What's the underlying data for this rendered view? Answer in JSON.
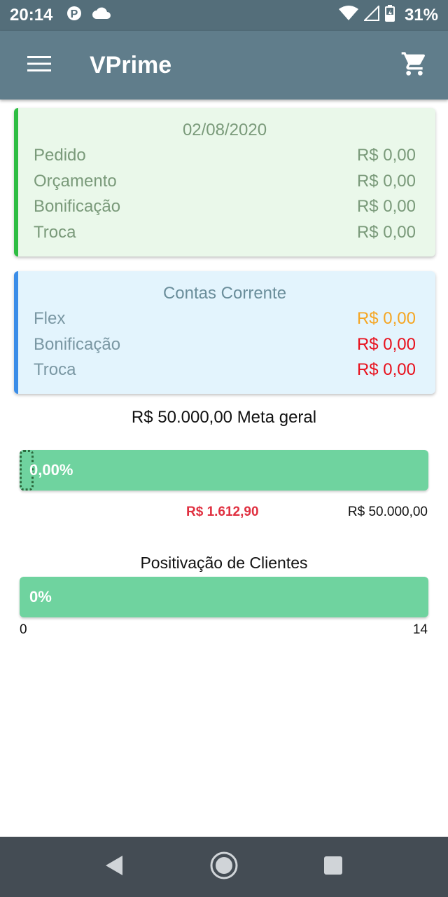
{
  "status_bar": {
    "time": "20:14",
    "battery_percent": "31%",
    "icons": [
      "parking-icon",
      "cloud-icon",
      "wifi-icon",
      "cellular-icon",
      "battery-icon"
    ]
  },
  "app_bar": {
    "title": "VPrime",
    "icons": [
      "menu-icon",
      "cart-icon"
    ]
  },
  "daily_card": {
    "date": "02/08/2020",
    "rows": [
      {
        "label": "Pedido",
        "value": "R$ 0,00"
      },
      {
        "label": "Orçamento",
        "value": "R$ 0,00"
      },
      {
        "label": "Bonificação",
        "value": "R$ 0,00"
      },
      {
        "label": "Troca",
        "value": "R$ 0,00"
      }
    ],
    "accent_color": "#2ebd43"
  },
  "accounts_card": {
    "title": "Contas Corrente",
    "rows": [
      {
        "label": "Flex",
        "value": "R$ 0,00",
        "color": "#f5a623"
      },
      {
        "label": "Bonificação",
        "value": "R$ 0,00",
        "color": "#e8101c"
      },
      {
        "label": "Troca",
        "value": "R$ 0,00",
        "color": "#e8101c"
      }
    ],
    "accent_color": "#3b8de8"
  },
  "meta": {
    "title": "R$ 50.000,00 Meta geral",
    "progress_label": "0,00%",
    "progress_fraction": 0.0,
    "current": "R$ 1.612,90",
    "target": "R$ 50.000,00"
  },
  "positivacao": {
    "title": "Positivação de Clientes",
    "progress_label": "0%",
    "progress_fraction": 0.0,
    "min": "0",
    "max": "14"
  },
  "colors": {
    "status_bar": "#546e7a",
    "app_bar": "#607d8b",
    "progress": "#6fd39f",
    "nav_bar": "#444c54"
  }
}
